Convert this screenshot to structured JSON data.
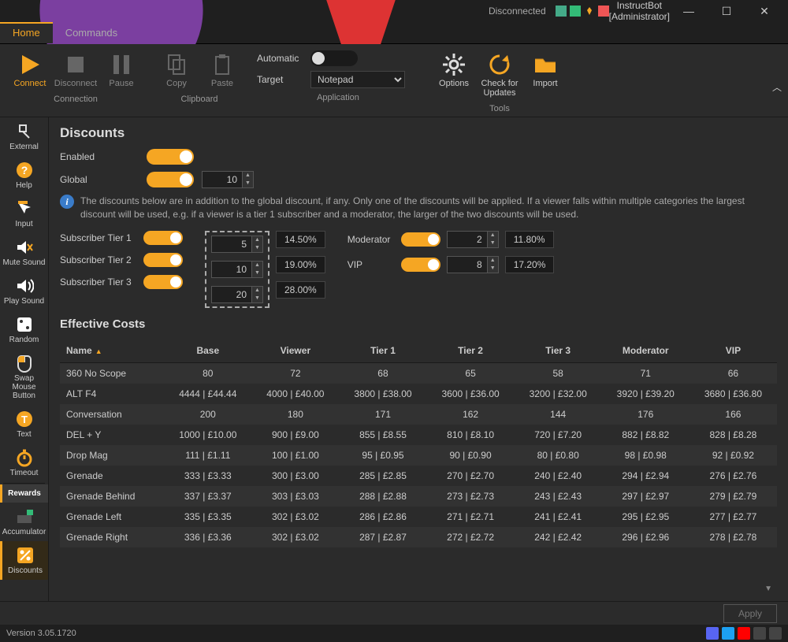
{
  "titlebar": {
    "status": "Disconnected",
    "title": "InstructBot [Administrator]"
  },
  "tabs": {
    "home": "Home",
    "commands": "Commands"
  },
  "ribbon": {
    "connect": "Connect",
    "disconnect": "Disconnect",
    "pause": "Pause",
    "copy": "Copy",
    "paste": "Paste",
    "options": "Options",
    "check": "Check for Updates",
    "import": "Import",
    "grp_connection": "Connection",
    "grp_clipboard": "Clipboard",
    "grp_application": "Application",
    "grp_tools": "Tools",
    "automatic": "Automatic",
    "target": "Target",
    "target_value": "Notepad"
  },
  "sidebar": {
    "items": [
      {
        "label": "External"
      },
      {
        "label": "Help"
      },
      {
        "label": "Input"
      },
      {
        "label": "Mute Sound"
      },
      {
        "label": "Play Sound"
      },
      {
        "label": "Random"
      },
      {
        "label": "Swap Mouse Button"
      },
      {
        "label": "Text"
      },
      {
        "label": "Timeout"
      },
      {
        "label": "Rewards"
      },
      {
        "label": "Accumulator"
      },
      {
        "label": "Discounts"
      }
    ]
  },
  "discounts": {
    "heading": "Discounts",
    "enabled": "Enabled",
    "global": "Global",
    "global_value": "10",
    "info": "The discounts below are in addition to the global discount, if any. Only one of the discounts will be applied. If a viewer falls within multiple categories the largest discount will be used, e.g. if a viewer is a tier 1 subscriber and a moderator, the larger of the two discounts will be used.",
    "tier1": "Subscriber Tier 1",
    "tier1_val": "5",
    "tier1_pct": "14.50%",
    "tier2": "Subscriber Tier 2",
    "tier2_val": "10",
    "tier2_pct": "19.00%",
    "tier3": "Subscriber Tier 3",
    "tier3_val": "20",
    "tier3_pct": "28.00%",
    "mod": "Moderator",
    "mod_val": "2",
    "mod_pct": "11.80%",
    "vip": "VIP",
    "vip_val": "8",
    "vip_pct": "17.20%"
  },
  "effective": {
    "heading": "Effective Costs",
    "cols": {
      "name": "Name",
      "base": "Base",
      "viewer": "Viewer",
      "t1": "Tier 1",
      "t2": "Tier 2",
      "t3": "Tier 3",
      "mod": "Moderator",
      "vip": "VIP"
    },
    "rows": [
      {
        "name": "360 No Scope",
        "base": "80",
        "viewer": "72",
        "t1": "68",
        "t2": "65",
        "t3": "58",
        "mod": "71",
        "vip": "66"
      },
      {
        "name": "ALT F4",
        "base": "4444 | £44.44",
        "viewer": "4000 | £40.00",
        "t1": "3800 | £38.00",
        "t2": "3600 | £36.00",
        "t3": "3200 | £32.00",
        "mod": "3920 | £39.20",
        "vip": "3680 | £36.80"
      },
      {
        "name": "Conversation",
        "base": "200",
        "viewer": "180",
        "t1": "171",
        "t2": "162",
        "t3": "144",
        "mod": "176",
        "vip": "166"
      },
      {
        "name": "DEL + Y",
        "base": "1000 | £10.00",
        "viewer": "900 | £9.00",
        "t1": "855 | £8.55",
        "t2": "810 | £8.10",
        "t3": "720 | £7.20",
        "mod": "882 | £8.82",
        "vip": "828 | £8.28"
      },
      {
        "name": "Drop Mag",
        "base": "111 | £1.11",
        "viewer": "100 | £1.00",
        "t1": "95 | £0.95",
        "t2": "90 | £0.90",
        "t3": "80 | £0.80",
        "mod": "98 | £0.98",
        "vip": "92 | £0.92"
      },
      {
        "name": "Grenade",
        "base": "333 | £3.33",
        "viewer": "300 | £3.00",
        "t1": "285 | £2.85",
        "t2": "270 | £2.70",
        "t3": "240 | £2.40",
        "mod": "294 | £2.94",
        "vip": "276 | £2.76"
      },
      {
        "name": "Grenade Behind",
        "base": "337 | £3.37",
        "viewer": "303 | £3.03",
        "t1": "288 | £2.88",
        "t2": "273 | £2.73",
        "t3": "243 | £2.43",
        "mod": "297 | £2.97",
        "vip": "279 | £2.79"
      },
      {
        "name": "Grenade Left",
        "base": "335 | £3.35",
        "viewer": "302 | £3.02",
        "t1": "286 | £2.86",
        "t2": "271 | £2.71",
        "t3": "241 | £2.41",
        "mod": "295 | £2.95",
        "vip": "277 | £2.77"
      },
      {
        "name": "Grenade Right",
        "base": "336 | £3.36",
        "viewer": "302 | £3.02",
        "t1": "287 | £2.87",
        "t2": "272 | £2.72",
        "t3": "242 | £2.42",
        "mod": "296 | £2.96",
        "vip": "278 | £2.78"
      }
    ]
  },
  "apply": "Apply",
  "version": "Version 3.05.1720"
}
